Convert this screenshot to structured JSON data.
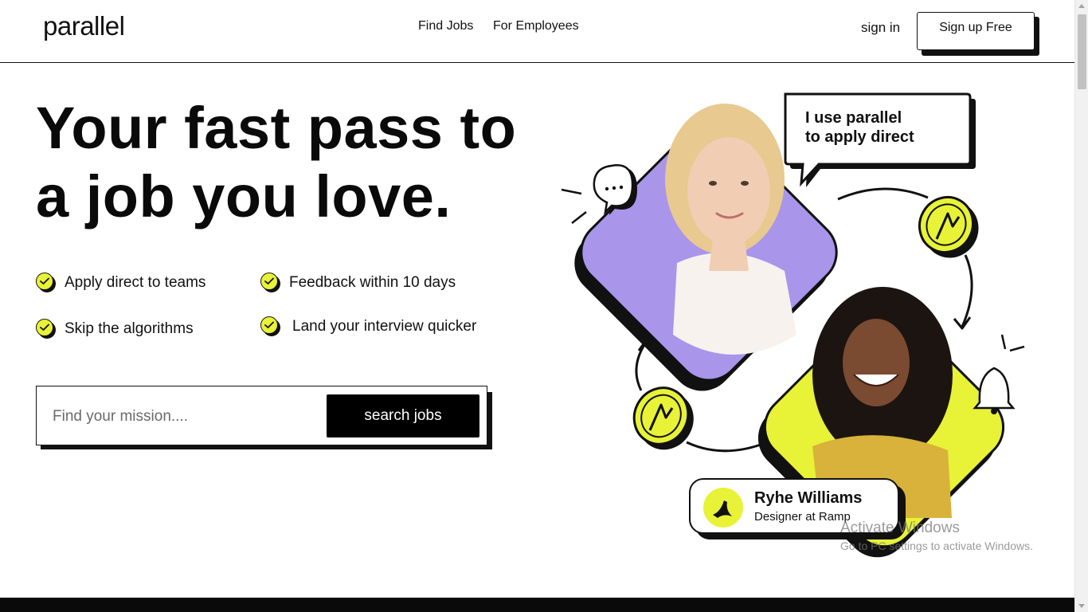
{
  "header": {
    "logo": "parallel",
    "nav": [
      "Find Jobs",
      "For Employees"
    ],
    "sign_in": "sign in",
    "sign_up": "Sign up Free"
  },
  "hero": {
    "title_line1": "Your fast pass to",
    "title_line2": "a job you love.",
    "features": [
      "Apply direct to teams",
      "Feedback within 10 days",
      "Skip the algorithms",
      "Land your interview quicker"
    ]
  },
  "search": {
    "placeholder": "Find your mission....",
    "button": "search jobs"
  },
  "illustration": {
    "bubble_line1": "I use parallel",
    "bubble_line2": "to apply direct",
    "profile_name": "Ryhe Williams",
    "profile_role": "Designer at Ramp"
  },
  "watermark": {
    "title": "Activate Windows",
    "subtitle": "Go to PC settings to activate Windows."
  },
  "colors": {
    "accent_yellow": "#e8f236",
    "accent_purple": "#a995ea",
    "ink": "#111111"
  },
  "icons": [
    "check-icon",
    "chat-bubble-icon",
    "bell-icon",
    "coin-arrow-icon",
    "cycle-arrow-icon",
    "ramp-logo-icon"
  ]
}
